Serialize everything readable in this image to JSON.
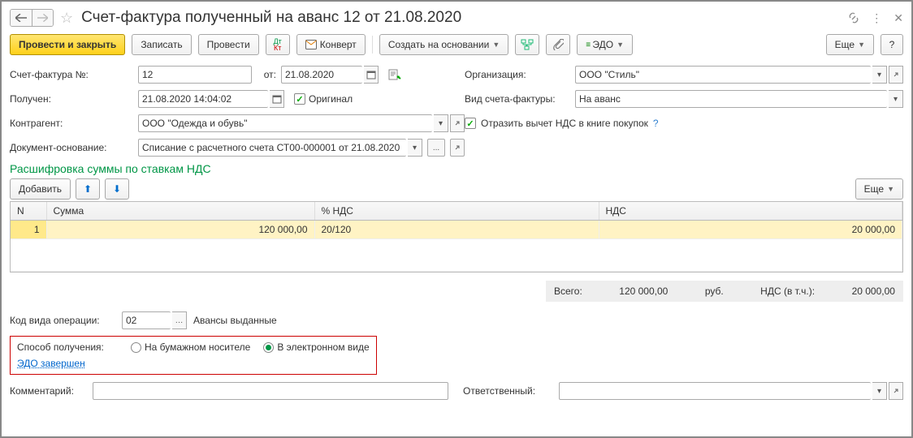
{
  "title": "Счет-фактура полученный на аванс 12 от 21.08.2020",
  "toolbar": {
    "post_close": "Провести и закрыть",
    "save": "Записать",
    "post": "Провести",
    "convert": "Конверт",
    "create_basis": "Создать на основании",
    "edo": "ЭДО",
    "more": "Еще",
    "help": "?"
  },
  "fields": {
    "number_label": "Счет-фактура №:",
    "number": "12",
    "date_label": "от:",
    "date": "21.08.2020",
    "received_label": "Получен:",
    "received": "21.08.2020 14:04:02",
    "original": "Оригинал",
    "contr_label": "Контрагент:",
    "contr": "ООО \"Одежда и обувь\"",
    "basis_label": "Документ-основание:",
    "basis": "Списание с расчетного счета СТ00-000001 от 21.08.2020",
    "basis_more": "...",
    "org_label": "Организация:",
    "org": "ООО \"Стиль\"",
    "kind_label": "Вид счета-фактуры:",
    "kind": "На аванс",
    "reflect": "Отразить вычет НДС в книге покупок",
    "reflect_help": "?"
  },
  "section_title": "Расшифровка суммы по ставкам НДС",
  "grid_toolbar": {
    "add": "Добавить",
    "more": "Еще"
  },
  "grid": {
    "cols": {
      "n": "N",
      "sum": "Сумма",
      "rate": "% НДС",
      "vat": "НДС"
    },
    "row": {
      "n": "1",
      "sum": "120 000,00",
      "rate": "20/120",
      "vat": "20 000,00"
    }
  },
  "totals": {
    "total_label": "Всего:",
    "total": "120 000,00",
    "currency": "руб.",
    "vat_label": "НДС (в т.ч.):",
    "vat": "20 000,00"
  },
  "ops": {
    "code_label": "Код вида операции:",
    "code": "02",
    "code_text": "Авансы выданные"
  },
  "delivery": {
    "label": "Способ получения:",
    "paper": "На бумажном носителе",
    "electronic": "В электронном виде",
    "edo_status": "ЭДО завершен"
  },
  "footer": {
    "comment_label": "Комментарий:",
    "comment": "",
    "resp_label": "Ответственный:",
    "resp": ""
  }
}
